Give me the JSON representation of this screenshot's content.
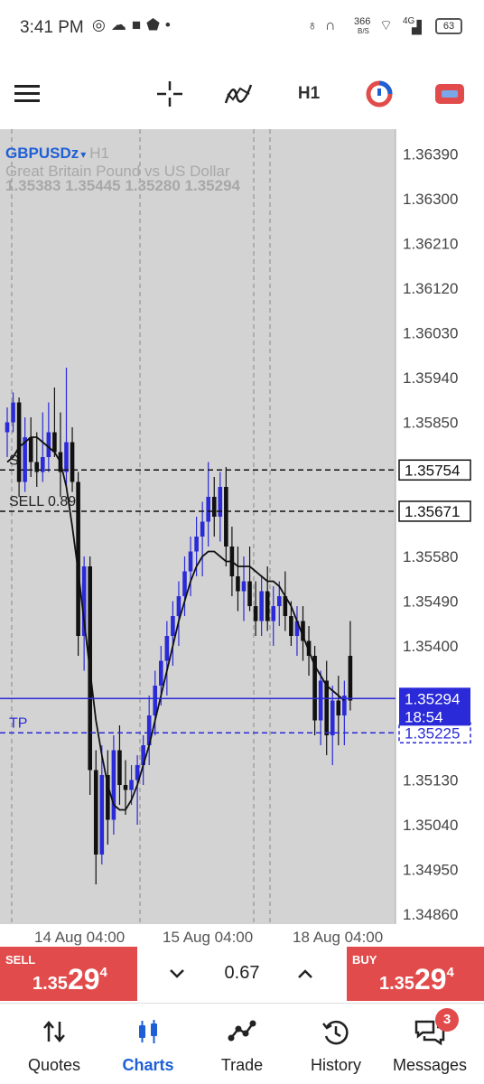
{
  "status_bar": {
    "time": "3:41 PM",
    "network_speed": "366",
    "network_unit": "B/S",
    "network_type": "4G",
    "battery": "63"
  },
  "toolbar": {
    "items": [
      "menu-icon",
      "crosshair-icon",
      "indicators-icon",
      "timeframe",
      "objects-icon",
      "trade-icon"
    ],
    "timeframe": "H1"
  },
  "chart": {
    "symbol": "GBPUSDz",
    "dropdown": "▾",
    "timeframe": "H1",
    "description": "Great Britain Pound vs US Dollar",
    "ohlc": "1.35383 1.35445 1.35280 1.35294",
    "colors": {
      "bull": "#2a2ad8",
      "bear": "#111111",
      "background": "#d3d3d3",
      "bid_line": "#2a2ad8",
      "tp_line": "#2a2ad8"
    },
    "price_axis": [
      "1.36390",
      "1.36300",
      "1.36210",
      "1.36120",
      "1.36030",
      "1.35940",
      "1.35850",
      "1.35580",
      "1.35490",
      "1.35400",
      "1.35130",
      "1.35040",
      "1.34950",
      "1.34860"
    ],
    "time_axis": [
      "14 Aug 04:00",
      "15 Aug 04:00",
      "18 Aug 04:00"
    ],
    "lines": [
      {
        "label": "S",
        "price": "1.35754"
      },
      {
        "label": "SELL 0.89",
        "price": "1.35671"
      },
      {
        "label": "TP",
        "price": "1.35225"
      }
    ],
    "bid": {
      "price": "1.35294",
      "countdown": "18:54"
    }
  },
  "chart_data": {
    "type": "candlestick",
    "symbol": "GBPUSDz",
    "timeframe": "H1",
    "ylim": [
      1.3484,
      1.3644
    ],
    "price_ticks": [
      1.3639,
      1.363,
      1.3621,
      1.3612,
      1.3603,
      1.3594,
      1.3585,
      1.3558,
      1.3549,
      1.354,
      1.3513,
      1.3504,
      1.3495,
      1.3486
    ],
    "x_labels": [
      "14 Aug 04:00",
      "15 Aug 04:00",
      "18 Aug 04:00"
    ],
    "x_label_index": [
      5,
      24,
      48
    ],
    "horizontal_lines": [
      {
        "label": "S",
        "value": 1.35754,
        "style": "dashed"
      },
      {
        "label": "SELL 0.89",
        "value": 1.35671,
        "style": "dashed"
      },
      {
        "label": "TP",
        "value": 1.35225,
        "style": "dashed"
      },
      {
        "label": "Bid",
        "value": 1.35294,
        "style": "solid"
      }
    ],
    "candles": [
      [
        1.3583,
        1.3588,
        1.3578,
        1.3585
      ],
      [
        1.3585,
        1.3591,
        1.3583,
        1.3589
      ],
      [
        1.3589,
        1.359,
        1.357,
        1.3573
      ],
      [
        1.3573,
        1.3586,
        1.3571,
        1.3582
      ],
      [
        1.3582,
        1.3586,
        1.3574,
        1.3577
      ],
      [
        1.3577,
        1.3583,
        1.3572,
        1.3575
      ],
      [
        1.3575,
        1.3587,
        1.3573,
        1.3578
      ],
      [
        1.3578,
        1.3589,
        1.3575,
        1.3583
      ],
      [
        1.3583,
        1.3592,
        1.3578,
        1.3579
      ],
      [
        1.3579,
        1.3587,
        1.357,
        1.3575
      ],
      [
        1.3575,
        1.3596,
        1.3572,
        1.3581
      ],
      [
        1.3581,
        1.3584,
        1.3571,
        1.3573
      ],
      [
        1.3573,
        1.3575,
        1.3538,
        1.3542
      ],
      [
        1.3542,
        1.3558,
        1.3535,
        1.3556
      ],
      [
        1.3556,
        1.3558,
        1.351,
        1.3515
      ],
      [
        1.3515,
        1.3519,
        1.3492,
        1.3498
      ],
      [
        1.3498,
        1.352,
        1.3496,
        1.3514
      ],
      [
        1.3514,
        1.3519,
        1.35,
        1.3505
      ],
      [
        1.3505,
        1.3522,
        1.3502,
        1.3519
      ],
      [
        1.3519,
        1.3524,
        1.3508,
        1.3512
      ],
      [
        1.3512,
        1.3517,
        1.3506,
        1.3511
      ],
      [
        1.3511,
        1.3516,
        1.3508,
        1.3513
      ],
      [
        1.3513,
        1.3518,
        1.3504,
        1.3516
      ],
      [
        1.3516,
        1.3522,
        1.3512,
        1.352
      ],
      [
        1.352,
        1.353,
        1.3516,
        1.3526
      ],
      [
        1.3526,
        1.3535,
        1.3522,
        1.3532
      ],
      [
        1.3532,
        1.354,
        1.3528,
        1.3537
      ],
      [
        1.3537,
        1.3545,
        1.353,
        1.3542
      ],
      [
        1.3542,
        1.3549,
        1.3536,
        1.3546
      ],
      [
        1.3546,
        1.3553,
        1.354,
        1.355
      ],
      [
        1.355,
        1.3558,
        1.3546,
        1.3555
      ],
      [
        1.3555,
        1.3562,
        1.355,
        1.3559
      ],
      [
        1.3559,
        1.3566,
        1.3554,
        1.3562
      ],
      [
        1.3562,
        1.3569,
        1.3554,
        1.3565
      ],
      [
        1.3565,
        1.3577,
        1.356,
        1.357
      ],
      [
        1.357,
        1.3574,
        1.3562,
        1.3566
      ],
      [
        1.3566,
        1.3575,
        1.3561,
        1.3572
      ],
      [
        1.3572,
        1.3576,
        1.3556,
        1.356
      ],
      [
        1.356,
        1.3564,
        1.355,
        1.3554
      ],
      [
        1.3554,
        1.356,
        1.3547,
        1.3551
      ],
      [
        1.3551,
        1.3558,
        1.3545,
        1.3553
      ],
      [
        1.3553,
        1.356,
        1.3547,
        1.3548
      ],
      [
        1.3548,
        1.3553,
        1.3542,
        1.3545
      ],
      [
        1.3545,
        1.3554,
        1.3542,
        1.3551
      ],
      [
        1.3551,
        1.3556,
        1.3543,
        1.3545
      ],
      [
        1.3545,
        1.3552,
        1.354,
        1.3548
      ],
      [
        1.3548,
        1.3553,
        1.3544,
        1.355
      ],
      [
        1.355,
        1.3555,
        1.3543,
        1.3546
      ],
      [
        1.3546,
        1.3549,
        1.354,
        1.3542
      ],
      [
        1.3542,
        1.3548,
        1.3538,
        1.3545
      ],
      [
        1.3545,
        1.3548,
        1.3537,
        1.3541
      ],
      [
        1.3541,
        1.3544,
        1.3534,
        1.3538
      ],
      [
        1.3538,
        1.354,
        1.3522,
        1.3525
      ],
      [
        1.3525,
        1.3535,
        1.352,
        1.3533
      ],
      [
        1.3533,
        1.3537,
        1.3518,
        1.3522
      ],
      [
        1.3522,
        1.3532,
        1.3516,
        1.3529
      ],
      [
        1.3529,
        1.3534,
        1.352,
        1.3526
      ],
      [
        1.3526,
        1.3533,
        1.352,
        1.353
      ],
      [
        1.3538,
        1.3545,
        1.3527,
        1.3529
      ]
    ],
    "moving_average": [
      1.3577,
      1.3578,
      1.358,
      1.3581,
      1.3582,
      1.3582,
      1.3581,
      1.358,
      1.3579,
      1.3577,
      1.3572,
      1.3564,
      1.3555,
      1.3545,
      1.3535,
      1.3525,
      1.3518,
      1.3512,
      1.3508,
      1.3507,
      1.3507,
      1.3509,
      1.3512,
      1.3516,
      1.352,
      1.3525,
      1.353,
      1.3535,
      1.354,
      1.3545,
      1.3549,
      1.3553,
      1.3556,
      1.3558,
      1.3559,
      1.3559,
      1.3558,
      1.3557,
      1.3557,
      1.3556,
      1.3556,
      1.3556,
      1.3555,
      1.3554,
      1.3553,
      1.3553,
      1.3552,
      1.355,
      1.3548,
      1.3545,
      1.3542,
      1.3539,
      1.3536,
      1.3534,
      1.3532,
      1.3531,
      1.353,
      1.3529
    ]
  },
  "order_bar": {
    "sell": {
      "label": "SELL",
      "prefix": "1.35",
      "big": "29",
      "sup": "4"
    },
    "lot": "0.67",
    "buy": {
      "label": "BUY",
      "prefix": "1.35",
      "big": "29",
      "sup": "4"
    }
  },
  "nav": {
    "items": [
      {
        "label": "Quotes",
        "icon": "quotes-icon"
      },
      {
        "label": "Charts",
        "icon": "charts-icon"
      },
      {
        "label": "Trade",
        "icon": "trade-icon"
      },
      {
        "label": "History",
        "icon": "history-icon"
      },
      {
        "label": "Messages",
        "icon": "messages-icon"
      }
    ],
    "messages_badge": "3"
  }
}
